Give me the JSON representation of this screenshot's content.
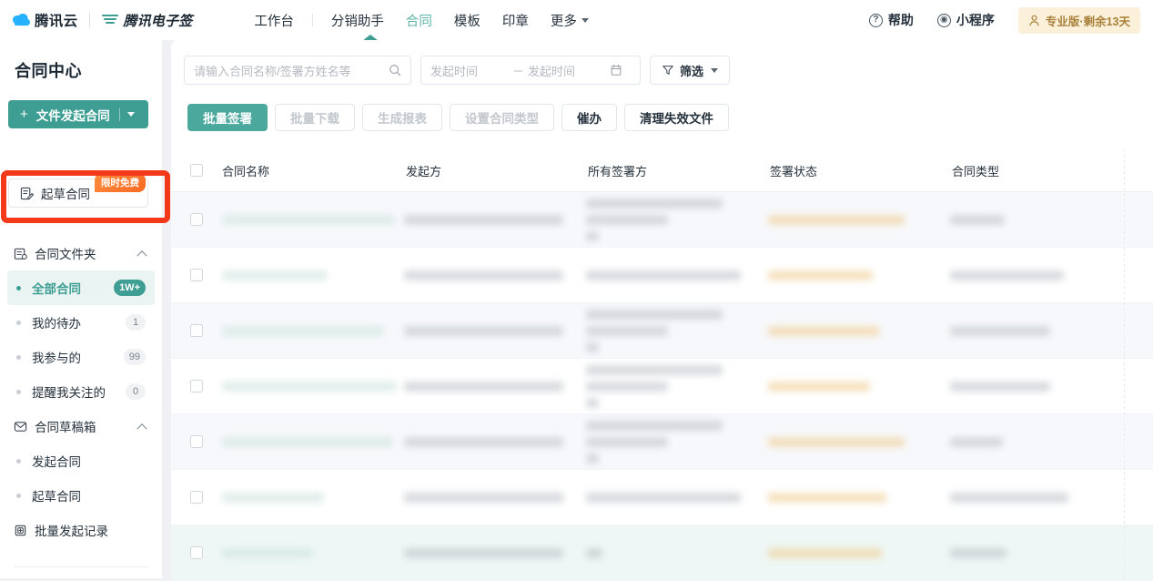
{
  "topnav": {
    "brand_cloud": "腾讯云",
    "brand_product": "腾讯电子签",
    "items": [
      {
        "label": "工作台",
        "active": false
      },
      {
        "label": "分销助手",
        "active": false
      },
      {
        "label": "合同",
        "active": true
      },
      {
        "label": "模板",
        "active": false
      },
      {
        "label": "印章",
        "active": false
      },
      {
        "label": "更多",
        "active": false,
        "has_caret": true
      }
    ],
    "help_label": "帮助",
    "miniprogram_label": "小程序",
    "pro_badge": "专业版·剩余13天"
  },
  "sidebar": {
    "title": "合同中心",
    "primary_button": "文件发起合同",
    "secondary_button": "起草合同",
    "free_badge": "限时免费",
    "groups": [
      {
        "label": "合同文件夹",
        "items": [
          {
            "label": "全部合同",
            "count": "1W+",
            "active": true
          },
          {
            "label": "我的待办",
            "count": "1",
            "active": false
          },
          {
            "label": "我参与的",
            "count": "99",
            "active": false
          },
          {
            "label": "提醒我关注的",
            "count": "0",
            "active": false
          }
        ]
      },
      {
        "label": "合同草稿箱",
        "items": [
          {
            "label": "发起合同",
            "count": "",
            "active": false
          },
          {
            "label": "起草合同",
            "count": "",
            "active": false
          }
        ]
      }
    ],
    "batch_record": "批量发起记录"
  },
  "toolbar": {
    "search_placeholder": "请输入合同名称/签署方姓名等",
    "date_start_placeholder": "发起时间",
    "date_end_placeholder": "发起时间",
    "date_separator": "－",
    "filter_label": "筛选"
  },
  "actions": [
    {
      "label": "批量签署",
      "state": "primary"
    },
    {
      "label": "批量下载",
      "state": "disabled"
    },
    {
      "label": "生成报表",
      "state": "disabled"
    },
    {
      "label": "设置合同类型",
      "state": "disabled"
    },
    {
      "label": "催办",
      "state": "default"
    },
    {
      "label": "清理失效文件",
      "state": "default"
    }
  ],
  "table": {
    "columns": [
      "合同名称",
      "发起方",
      "所有签署方",
      "签署状态",
      "合同类型"
    ],
    "rows": [
      {
        "shade": "odd",
        "name_w": 190,
        "from_w": 175,
        "signers": [
          150,
          90,
          14
        ],
        "status_w": 150,
        "type_w": 60
      },
      {
        "shade": "even",
        "name_w": 115,
        "from_w": 175,
        "signers": [
          170
        ],
        "status_w": 115,
        "type_w": 125
      },
      {
        "shade": "odd",
        "name_w": 178,
        "from_w": 175,
        "signers": [
          150,
          90,
          14
        ],
        "status_w": 122,
        "type_w": 110
      },
      {
        "shade": "even",
        "name_w": 192,
        "from_w": 175,
        "signers": [
          150,
          90,
          14
        ],
        "status_w": 112,
        "type_w": 110
      },
      {
        "shade": "odd",
        "name_w": 188,
        "from_w": 175,
        "signers": [
          150,
          90,
          14
        ],
        "status_w": 150,
        "type_w": 58
      },
      {
        "shade": "even",
        "name_w": 112,
        "from_w": 175,
        "signers": [
          170
        ],
        "status_w": 130,
        "type_w": 130
      },
      {
        "shade": "mint",
        "name_w": 100,
        "from_w": 175,
        "signers": [
          18
        ],
        "status_w": 125,
        "type_w": 62
      }
    ]
  },
  "colors": {
    "teal": "#3f9e93",
    "teal_light": "#eaf4f2",
    "orange": "#f96a23",
    "gold": "#a8803a",
    "annotation_red": "#f4381a",
    "page_bg": "#eff1f4"
  }
}
